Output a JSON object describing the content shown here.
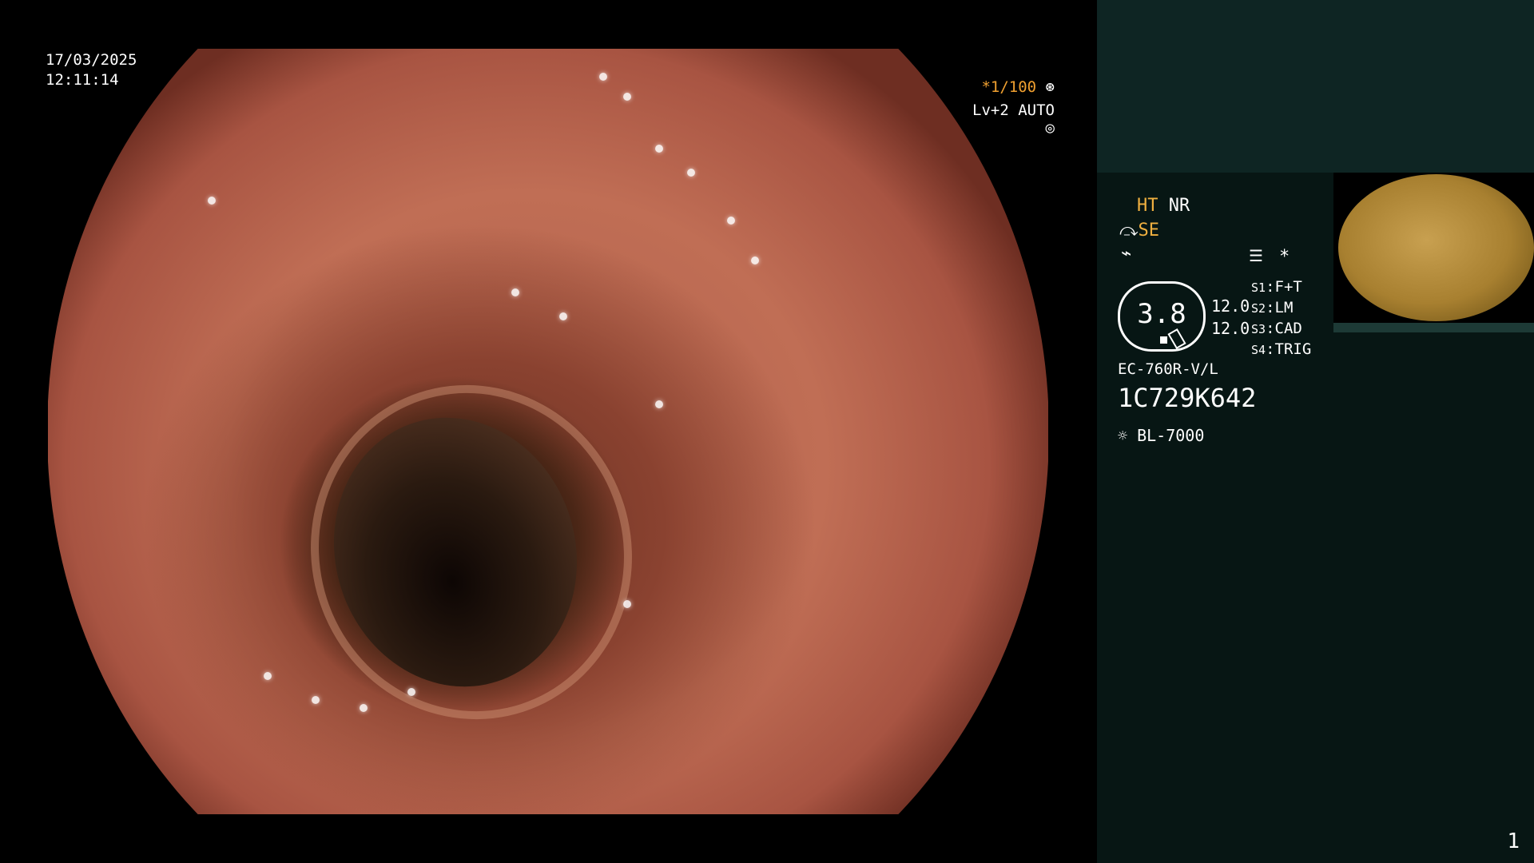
{
  "overlay": {
    "date": "17/03/2025",
    "time": "12:11:14",
    "shutter_prefix": "*",
    "shutter_value": "1/100",
    "shutter_icon": "aperture-icon",
    "level_text": "Lv+2 AUTO",
    "level_icon": "iris-icon"
  },
  "panel": {
    "ht_label": "HT",
    "nr_label": "NR",
    "se_label": "SE",
    "se_icon": "sword-icon",
    "f_icon": "lightning-icon",
    "menu_icon": "settings-list-icon",
    "star_label": "*",
    "gauge_value": "3.8",
    "value_1": "12.0",
    "value_2": "12.0",
    "slots": [
      {
        "key": "S1",
        "value": "F+T"
      },
      {
        "key": "S2",
        "value": "LM"
      },
      {
        "key": "S3",
        "value": "CAD"
      },
      {
        "key": "S4",
        "value": "TRIG"
      }
    ],
    "scope_model": "EC-760R-V/L",
    "scope_serial": "1C729K642",
    "light_icon": "lamp-icon",
    "light_source": "BL-7000",
    "page_number": "1"
  },
  "colors": {
    "accent_orange": "#f0b040",
    "panel_bg": "#071614",
    "panel_top_bg": "#0e2523"
  }
}
